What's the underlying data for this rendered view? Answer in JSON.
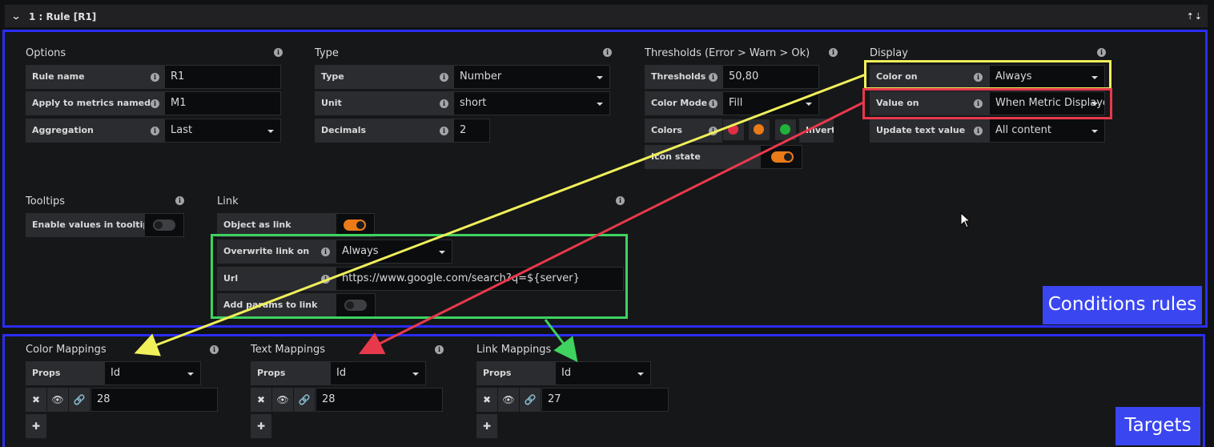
{
  "header": {
    "title": "1 : Rule [R1]",
    "arrows": "🡅🡇"
  },
  "options": {
    "title": "Options",
    "rule_name_label": "Rule name",
    "rule_name_value": "R1",
    "apply_label": "Apply to metrics named",
    "apply_value": "M1",
    "aggregation_label": "Aggregation",
    "aggregation_value": "Last"
  },
  "type": {
    "title": "Type",
    "type_label": "Type",
    "type_value": "Number",
    "unit_label": "Unit",
    "unit_value": "short",
    "decimals_label": "Decimals",
    "decimals_value": "2"
  },
  "thresholds": {
    "title": "Thresholds (Error > Warn > Ok)",
    "thresholds_label": "Thresholds",
    "thresholds_value": "50,80",
    "color_mode_label": "Color Mode",
    "color_mode_value": "Fill",
    "colors_label": "Colors",
    "invert_label": "Invert",
    "icon_state_label": "Icon state",
    "icon_state_on": true,
    "colors": [
      "#e02f44",
      "#eb7b18",
      "#1fb33a"
    ]
  },
  "display": {
    "title": "Display",
    "color_on_label": "Color on",
    "color_on_value": "Always",
    "value_on_label": "Value on",
    "value_on_value": "When Metric Displayed",
    "update_text_label": "Update text value",
    "update_text_value": "All content"
  },
  "tooltips": {
    "title": "Tooltips",
    "enable_label": "Enable values in tooltip",
    "enable_on": false
  },
  "link": {
    "title": "Link",
    "object_as_link_label": "Object as link",
    "object_as_link_on": true,
    "overwrite_label": "Overwrite link on",
    "overwrite_value": "Always",
    "url_label": "Url",
    "url_value": "https://www.google.com/search?q=${server}",
    "add_params_label": "Add params to link",
    "add_params_on": false
  },
  "mappings": {
    "color": {
      "title": "Color Mappings",
      "props_label": "Props",
      "props_value": "Id",
      "value": "28"
    },
    "text": {
      "title": "Text Mappings",
      "props_label": "Props",
      "props_value": "Id",
      "value": "28"
    },
    "link": {
      "title": "Link Mappings",
      "props_label": "Props",
      "props_value": "Id",
      "value": "27"
    }
  },
  "icons": {
    "info": "info-icon",
    "delete": "close-icon",
    "eye": "eye-icon",
    "link": "link-icon",
    "add": "plus-icon"
  },
  "annotations": {
    "conditions_label": "Conditions rules",
    "targets_label": "Targets"
  },
  "colors": {
    "box": "#2a2ef0",
    "yellow": "#f0f05a",
    "red": "#e8394c",
    "green": "#3fd25f",
    "badge": "#3a46f0",
    "toggle_on": "#eb7b18"
  }
}
